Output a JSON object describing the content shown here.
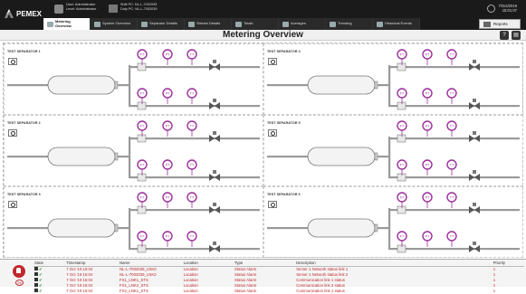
{
  "header": {
    "logo_text": "PEMEX",
    "user_line": "User: Administrator",
    "level_line": "Level: Administrator",
    "shift_line": "Shift PC: NL-L-7002039",
    "duty_line": "Duty PC: NL-L-7002039",
    "date": "7/Oct/2019",
    "time": "15:01:07",
    "reports_label": "Reports"
  },
  "nav": {
    "tabs": [
      {
        "label": "Metering Overview",
        "active": true
      },
      {
        "label": "System Overview",
        "active": false
      },
      {
        "label": "Separator Details",
        "active": false
      },
      {
        "label": "Stream Details",
        "active": false
      },
      {
        "label": "Totals",
        "active": false
      },
      {
        "label": "Averages",
        "active": false
      },
      {
        "label": "Trending",
        "active": false
      },
      {
        "label": "Historical Events",
        "active": false
      }
    ]
  },
  "page": {
    "title": "Metering Overview",
    "help_icon": "help-icon",
    "print_icon": "print-icon"
  },
  "separators": [
    {
      "name": "TEST SEPARATOR 1"
    },
    {
      "name": "TEST SEPARATOR 4"
    },
    {
      "name": "TEST SEPARATOR 2"
    },
    {
      "name": "TEST SEPARATOR 5"
    },
    {
      "name": "TEST SEPARATOR 3"
    },
    {
      "name": "TEST SEPARATOR 6"
    }
  ],
  "instrument_tags": [
    "FT",
    "PT",
    "TT"
  ],
  "alarms": {
    "count": "26",
    "columns": [
      "State",
      "Timestamp",
      "Name",
      "Location",
      "Type",
      "Description",
      "Priority"
    ],
    "rows": [
      {
        "timestamp": "7 Oct '19 15:04",
        "name": "NL-L-7002039_LNK0",
        "location": "Location",
        "type": "Status Alarm",
        "description": "Server 1 Network status link 1",
        "priority": "1"
      },
      {
        "timestamp": "7 Oct '19 15:04",
        "name": "NL-L-7002039_LNK2",
        "location": "Location",
        "type": "Status Alarm",
        "description": "Server 1 Network status link 2",
        "priority": "1"
      },
      {
        "timestamp": "7 Oct '19 15:04",
        "name": "FX1_LNK1_STS",
        "location": "Location",
        "type": "Status Alarm",
        "description": "Communication link 1 status",
        "priority": "1"
      },
      {
        "timestamp": "7 Oct '19 15:04",
        "name": "FX1_LNK2_STS",
        "location": "Location",
        "type": "Status Alarm",
        "description": "Communication link 2 status",
        "priority": "1"
      },
      {
        "timestamp": "7 Oct '19 15:04",
        "name": "FX2_LNK1_STS",
        "location": "Location",
        "type": "Status Alarm",
        "description": "Communication link 1 status",
        "priority": "1"
      }
    ]
  },
  "colors": {
    "header_bg": "#1a1a1a",
    "pipe": "#9a9a9a",
    "instrument": "#9b2f9b",
    "alarm": "#c0282d",
    "ok": "#1a8a1a"
  }
}
